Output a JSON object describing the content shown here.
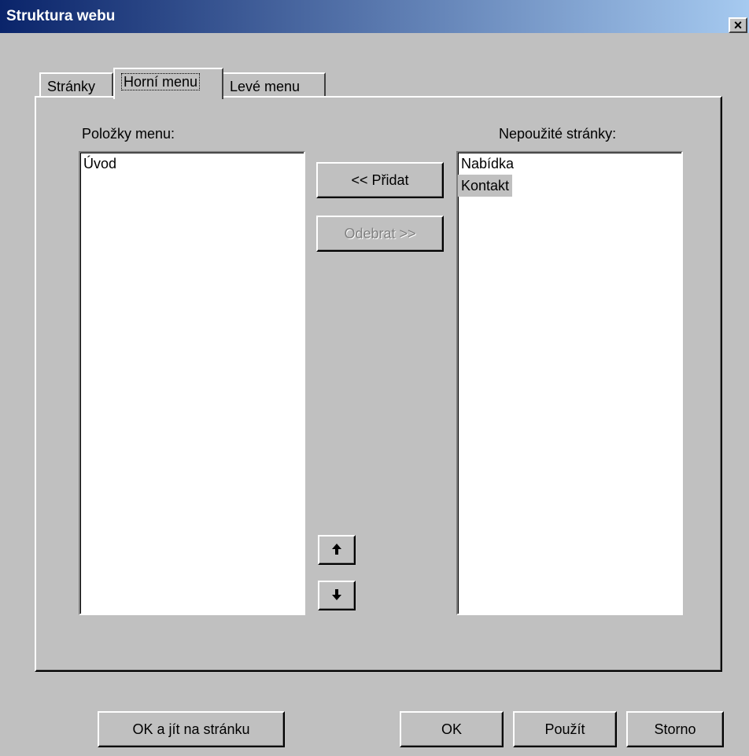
{
  "window": {
    "title": "Struktura webu",
    "close_label": "×"
  },
  "tabs": [
    {
      "label": "Stránky"
    },
    {
      "label": "Horní menu"
    },
    {
      "label": "Levé menu"
    }
  ],
  "active_tab": "Horní menu",
  "left_list": {
    "label": "Položky menu:",
    "items": [
      "Úvod"
    ]
  },
  "right_list": {
    "label": "Nepoužité stránky:",
    "items": [
      "Nabídka",
      "Kontakt"
    ],
    "selected": "Kontakt"
  },
  "buttons": {
    "add": "<< Přidat",
    "remove": ">> Odebrat",
    "remove_display": "Odebrat >>",
    "up_icon": "arrow-up-icon",
    "down_icon": "arrow-down-icon",
    "ok_go": "OK a jít na stránku",
    "ok": "OK",
    "apply": "Použít",
    "cancel": "Storno"
  },
  "colors": {
    "titlebar_start": "#0a246a",
    "titlebar_end": "#a6caf0",
    "face": "#c0c0c0"
  }
}
